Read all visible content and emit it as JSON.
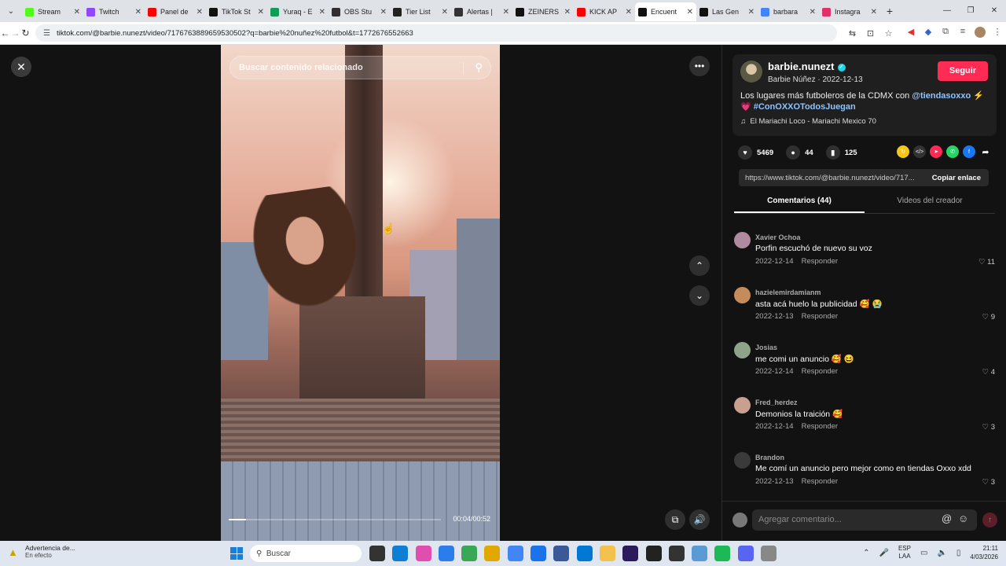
{
  "browser": {
    "tabs": [
      {
        "title": "Stream",
        "color": "#53fc18"
      },
      {
        "title": "Twitch",
        "color": "#9146ff"
      },
      {
        "title": "Panel de",
        "color": "#ff0000"
      },
      {
        "title": "TikTok St",
        "color": "#111111"
      },
      {
        "title": "Yuraq - E",
        "color": "#0f9d58"
      },
      {
        "title": "OBS Stu",
        "color": "#302e31"
      },
      {
        "title": "Tier List",
        "color": "#222222"
      },
      {
        "title": "Alertas |",
        "color": "#333333"
      },
      {
        "title": "ZEINERS",
        "color": "#111111"
      },
      {
        "title": "KICK AP",
        "color": "#ff0000"
      },
      {
        "title": "Encuent",
        "color": "#111111",
        "active": true
      },
      {
        "title": "Las Gen",
        "color": "#111111"
      },
      {
        "title": "barbara",
        "color": "#4285f4"
      },
      {
        "title": "Instagra",
        "color": "#e1306c"
      }
    ],
    "url": "tiktok.com/@barbie.nunezt/video/7176763889659530502?q=barbie%20nuñez%20futbol&t=1772676552663"
  },
  "video": {
    "search_placeholder": "Buscar contenido relacionado",
    "time": "00:04/00:52",
    "progress": 0.08
  },
  "author": {
    "username": "barbie.nunezt",
    "subtitle": "Barbie Núñez · 2022-12-13",
    "follow_label": "Seguir",
    "description_text": "Los lugares más futboleros de la CDMX con ",
    "mention": "@tiendasoxxo",
    "description_emoji": " ⚡",
    "hashtag_prefix": "💗 ",
    "hashtag": "#ConOXXOTodosJuegan",
    "music": "El Mariachi Loco - Mariachi Mexico 70"
  },
  "stats": {
    "likes": "5469",
    "comments": "44",
    "saves": "125"
  },
  "share": {
    "url": "https://www.tiktok.com/@barbie.nunezt/video/717...",
    "copy_label": "Copiar enlace"
  },
  "panel_tabs": {
    "comments": "Comentarios (44)",
    "creator_videos": "Videos del creador"
  },
  "comments": [
    {
      "user": "Xavier Ochoa",
      "text": "Porfin escuchó de nuevo su voz",
      "date": "2022-12-14",
      "reply": "Responder",
      "likes": "11",
      "color": "#b08aa0"
    },
    {
      "user": "hazielemirdamianm",
      "text": "asta acá huelo la publicidad 🥰 😭",
      "date": "2022-12-13",
      "reply": "Responder",
      "likes": "9",
      "color": "#c68b5a"
    },
    {
      "user": "Josias",
      "text": "me comi un anuncio 🥰 😆",
      "date": "2022-12-14",
      "reply": "Responder",
      "likes": "4",
      "color": "#8fa38a"
    },
    {
      "user": "Fred_herdez",
      "text": "Demonios la traición 🥰",
      "date": "2022-12-14",
      "reply": "Responder",
      "likes": "3",
      "color": "#c9a08f"
    },
    {
      "user": "Brandon",
      "text": "Me comí un anuncio pero mejor como en tiendas Oxxo xdd",
      "date": "2022-12-13",
      "reply": "Responder",
      "likes": "3",
      "color": "#3a3a3a"
    }
  ],
  "add_comment": {
    "placeholder": "Agregar comentario..."
  },
  "taskbar": {
    "warning_title": "Advertencia de...",
    "warning_sub": "En efecto",
    "search_label": "Buscar",
    "lang_top": "ESP",
    "lang_bottom": "LAA",
    "time": "21:11",
    "date": "4/03/2026"
  }
}
